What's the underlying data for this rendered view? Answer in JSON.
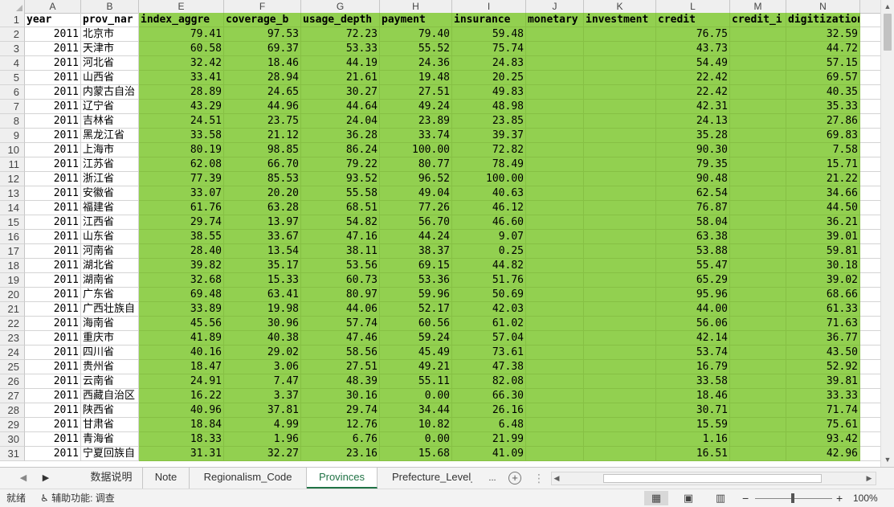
{
  "sheet": {
    "column_letters": [
      "A",
      "B",
      "E",
      "F",
      "G",
      "H",
      "I",
      "J",
      "K",
      "L",
      "M",
      "N"
    ],
    "headers": [
      "year",
      "prov_name",
      "index_aggregate",
      "coverage_breadth",
      "usage_depth",
      "payment",
      "insurance",
      "monetary_fund",
      "investment",
      "credit",
      "credit_investigation",
      "digitization_level"
    ],
    "header_shown": [
      "year",
      "prov_nar",
      "index_aggre",
      "coverage_b",
      "usage_depth",
      "payment",
      "insurance",
      "monetary",
      "investment",
      "credit",
      "credit_i",
      "digitization_"
    ],
    "rows": [
      {
        "n": "2",
        "year": "2011",
        "prov": "北京市",
        "v": [
          "79.41",
          "97.53",
          "72.23",
          "79.40",
          "59.48",
          "",
          "",
          "76.75",
          "",
          "32.59"
        ]
      },
      {
        "n": "3",
        "year": "2011",
        "prov": "天津市",
        "v": [
          "60.58",
          "69.37",
          "53.33",
          "55.52",
          "75.74",
          "",
          "",
          "43.73",
          "",
          "44.72"
        ]
      },
      {
        "n": "4",
        "year": "2011",
        "prov": "河北省",
        "v": [
          "32.42",
          "18.46",
          "44.19",
          "24.36",
          "24.83",
          "",
          "",
          "54.49",
          "",
          "57.15"
        ]
      },
      {
        "n": "5",
        "year": "2011",
        "prov": "山西省",
        "v": [
          "33.41",
          "28.94",
          "21.61",
          "19.48",
          "20.25",
          "",
          "",
          "22.42",
          "",
          "69.57"
        ]
      },
      {
        "n": "6",
        "year": "2011",
        "prov": "内蒙古自治",
        "v": [
          "28.89",
          "24.65",
          "30.27",
          "27.51",
          "49.83",
          "",
          "",
          "22.42",
          "",
          "40.35"
        ]
      },
      {
        "n": "7",
        "year": "2011",
        "prov": "辽宁省",
        "v": [
          "43.29",
          "44.96",
          "44.64",
          "49.24",
          "48.98",
          "",
          "",
          "42.31",
          "",
          "35.33"
        ]
      },
      {
        "n": "8",
        "year": "2011",
        "prov": "吉林省",
        "v": [
          "24.51",
          "23.75",
          "24.04",
          "23.89",
          "23.85",
          "",
          "",
          "24.13",
          "",
          "27.86"
        ]
      },
      {
        "n": "9",
        "year": "2011",
        "prov": "黑龙江省",
        "v": [
          "33.58",
          "21.12",
          "36.28",
          "33.74",
          "39.37",
          "",
          "",
          "35.28",
          "",
          "69.83"
        ]
      },
      {
        "n": "10",
        "year": "2011",
        "prov": "上海市",
        "v": [
          "80.19",
          "98.85",
          "86.24",
          "100.00",
          "72.82",
          "",
          "",
          "90.30",
          "",
          "7.58"
        ]
      },
      {
        "n": "11",
        "year": "2011",
        "prov": "江苏省",
        "v": [
          "62.08",
          "66.70",
          "79.22",
          "80.77",
          "78.49",
          "",
          "",
          "79.35",
          "",
          "15.71"
        ]
      },
      {
        "n": "12",
        "year": "2011",
        "prov": "浙江省",
        "v": [
          "77.39",
          "85.53",
          "93.52",
          "96.52",
          "100.00",
          "",
          "",
          "90.48",
          "",
          "21.22"
        ]
      },
      {
        "n": "13",
        "year": "2011",
        "prov": "安徽省",
        "v": [
          "33.07",
          "20.20",
          "55.58",
          "49.04",
          "40.63",
          "",
          "",
          "62.54",
          "",
          "34.66"
        ]
      },
      {
        "n": "14",
        "year": "2011",
        "prov": "福建省",
        "v": [
          "61.76",
          "63.28",
          "68.51",
          "77.26",
          "46.12",
          "",
          "",
          "76.87",
          "",
          "44.50"
        ]
      },
      {
        "n": "15",
        "year": "2011",
        "prov": "江西省",
        "v": [
          "29.74",
          "13.97",
          "54.82",
          "56.70",
          "46.60",
          "",
          "",
          "58.04",
          "",
          "36.21"
        ]
      },
      {
        "n": "16",
        "year": "2011",
        "prov": "山东省",
        "v": [
          "38.55",
          "33.67",
          "47.16",
          "44.24",
          "9.07",
          "",
          "",
          "63.38",
          "",
          "39.01"
        ]
      },
      {
        "n": "17",
        "year": "2011",
        "prov": "河南省",
        "v": [
          "28.40",
          "13.54",
          "38.11",
          "38.37",
          "0.25",
          "",
          "",
          "53.88",
          "",
          "59.81"
        ]
      },
      {
        "n": "18",
        "year": "2011",
        "prov": "湖北省",
        "v": [
          "39.82",
          "35.17",
          "53.56",
          "69.15",
          "44.82",
          "",
          "",
          "55.47",
          "",
          "30.18"
        ]
      },
      {
        "n": "19",
        "year": "2011",
        "prov": "湖南省",
        "v": [
          "32.68",
          "15.33",
          "60.73",
          "53.36",
          "51.76",
          "",
          "",
          "65.29",
          "",
          "39.02"
        ]
      },
      {
        "n": "20",
        "year": "2011",
        "prov": "广东省",
        "v": [
          "69.48",
          "63.41",
          "80.97",
          "59.96",
          "50.69",
          "",
          "",
          "95.96",
          "",
          "68.66"
        ]
      },
      {
        "n": "21",
        "year": "2011",
        "prov": "广西壮族自",
        "v": [
          "33.89",
          "19.98",
          "44.06",
          "52.17",
          "42.03",
          "",
          "",
          "44.00",
          "",
          "61.33"
        ]
      },
      {
        "n": "22",
        "year": "2011",
        "prov": "海南省",
        "v": [
          "45.56",
          "30.96",
          "57.74",
          "60.56",
          "61.02",
          "",
          "",
          "56.06",
          "",
          "71.63"
        ]
      },
      {
        "n": "23",
        "year": "2011",
        "prov": "重庆市",
        "v": [
          "41.89",
          "40.38",
          "47.46",
          "59.24",
          "57.04",
          "",
          "",
          "42.14",
          "",
          "36.77"
        ]
      },
      {
        "n": "24",
        "year": "2011",
        "prov": "四川省",
        "v": [
          "40.16",
          "29.02",
          "58.56",
          "45.49",
          "73.61",
          "",
          "",
          "53.74",
          "",
          "43.50"
        ]
      },
      {
        "n": "25",
        "year": "2011",
        "prov": "贵州省",
        "v": [
          "18.47",
          "3.06",
          "27.51",
          "49.21",
          "47.38",
          "",
          "",
          "16.79",
          "",
          "52.92"
        ]
      },
      {
        "n": "26",
        "year": "2011",
        "prov": "云南省",
        "v": [
          "24.91",
          "7.47",
          "48.39",
          "55.11",
          "82.08",
          "",
          "",
          "33.58",
          "",
          "39.81"
        ]
      },
      {
        "n": "27",
        "year": "2011",
        "prov": "西藏自治区",
        "v": [
          "16.22",
          "3.37",
          "30.16",
          "0.00",
          "66.30",
          "",
          "",
          "18.46",
          "",
          "33.33"
        ]
      },
      {
        "n": "28",
        "year": "2011",
        "prov": "陕西省",
        "v": [
          "40.96",
          "37.81",
          "29.74",
          "34.44",
          "26.16",
          "",
          "",
          "30.71",
          "",
          "71.74"
        ]
      },
      {
        "n": "29",
        "year": "2011",
        "prov": "甘肃省",
        "v": [
          "18.84",
          "4.99",
          "12.76",
          "10.82",
          "6.48",
          "",
          "",
          "15.59",
          "",
          "75.61"
        ]
      },
      {
        "n": "30",
        "year": "2011",
        "prov": "青海省",
        "v": [
          "18.33",
          "1.96",
          "6.76",
          "0.00",
          "21.99",
          "",
          "",
          "1.16",
          "",
          "93.42"
        ]
      },
      {
        "n": "31",
        "year": "2011",
        "prov": "宁夏回族自",
        "v": [
          "31.31",
          "32.27",
          "23.16",
          "15.68",
          "41.09",
          "",
          "",
          "16.51",
          "",
          "42.96"
        ]
      }
    ]
  },
  "tabs": {
    "items": [
      "数据说明",
      "Note",
      "Regionalism_Code",
      "Provinces",
      "Prefecture_Level_C"
    ],
    "active": "Provinces",
    "more": "...",
    "add": "+"
  },
  "status": {
    "ready": "就绪",
    "accessibility": "辅助功能: 调查",
    "zoom": "100%",
    "zoom_minus": "−",
    "zoom_plus": "+"
  },
  "colors": {
    "fill": "#92d050",
    "accent": "#217346"
  }
}
